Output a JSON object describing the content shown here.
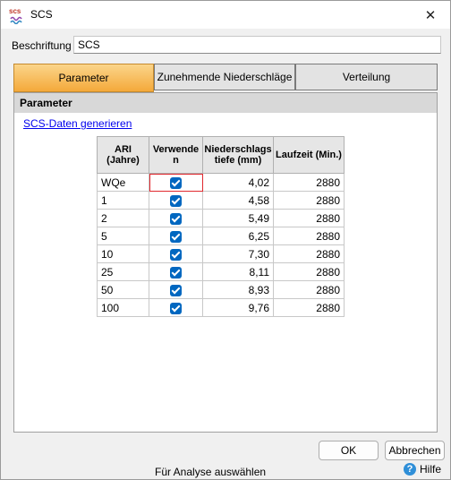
{
  "window": {
    "title": "SCS",
    "icon_text": "scs",
    "close_glyph": "✕"
  },
  "form": {
    "caption_label": "Beschriftung",
    "caption_value": "SCS"
  },
  "tabs": [
    {
      "label": "Parameter",
      "active": true
    },
    {
      "label": "Zunehmende Niederschläge",
      "active": false
    },
    {
      "label": "Verteilung",
      "active": false
    }
  ],
  "panel": {
    "header": "Parameter",
    "link": "SCS-Daten generieren"
  },
  "table": {
    "headers": {
      "ari": [
        "ARI",
        "(Jahre)"
      ],
      "use": [
        "Verwende",
        "n"
      ],
      "depth": [
        "Niederschlags",
        "tiefe (mm)"
      ],
      "duration": [
        "Laufzeit (Min.)"
      ]
    },
    "rows": [
      {
        "ari": "WQe",
        "use": true,
        "depth": "4,02",
        "duration": "2880"
      },
      {
        "ari": "1",
        "use": true,
        "depth": "4,58",
        "duration": "2880"
      },
      {
        "ari": "2",
        "use": true,
        "depth": "5,49",
        "duration": "2880"
      },
      {
        "ari": "5",
        "use": true,
        "depth": "6,25",
        "duration": "2880"
      },
      {
        "ari": "10",
        "use": true,
        "depth": "7,30",
        "duration": "2880"
      },
      {
        "ari": "25",
        "use": true,
        "depth": "8,11",
        "duration": "2880"
      },
      {
        "ari": "50",
        "use": true,
        "depth": "8,93",
        "duration": "2880"
      },
      {
        "ari": "100",
        "use": true,
        "depth": "9,76",
        "duration": "2880"
      }
    ]
  },
  "buttons": {
    "ok": "OK",
    "cancel": "Abbrechen",
    "help": "Hilfe"
  },
  "status": "Für Analyse auswählen",
  "colors": {
    "active_tab": "#f4a93a",
    "checkbox": "#0067c0",
    "selection": "#e0282e",
    "link": "#0000ee"
  }
}
